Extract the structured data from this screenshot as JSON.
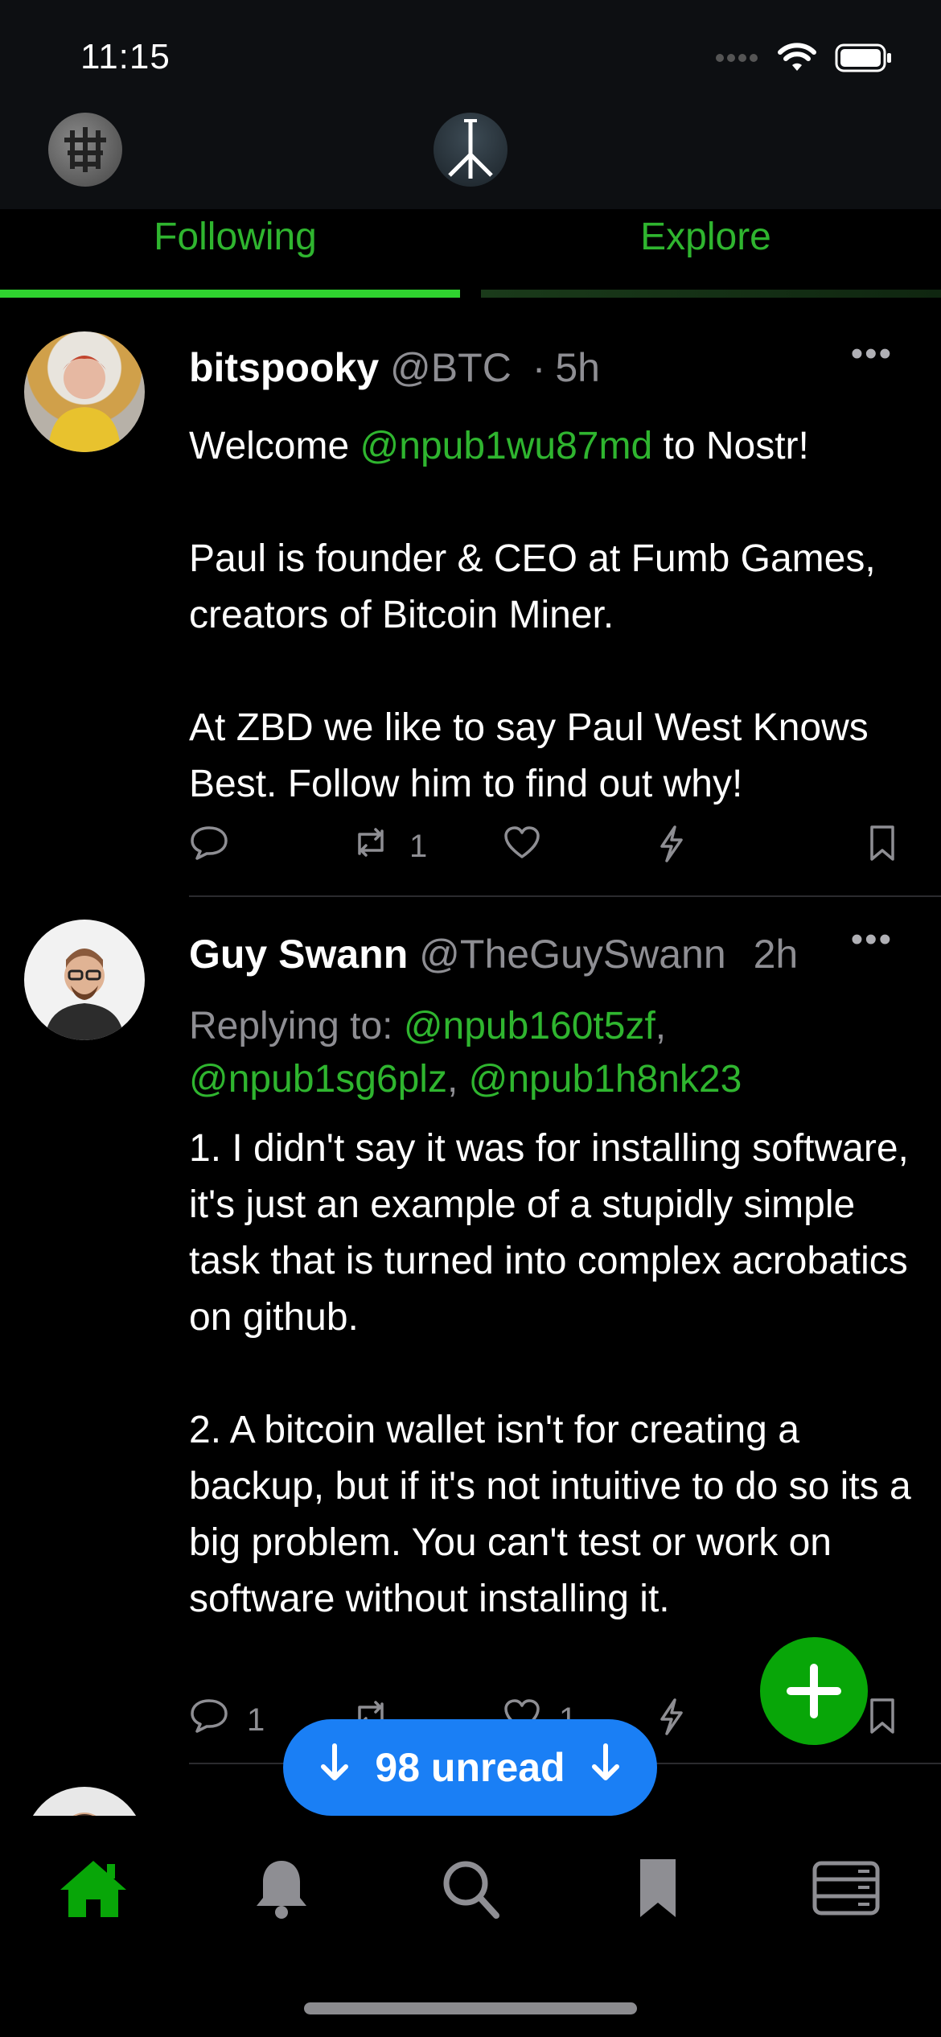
{
  "status_bar": {
    "time": "11:15"
  },
  "header": {
    "profile_avatar": "user-avatar",
    "logo": "app-logo"
  },
  "tabs": [
    {
      "label": "Following",
      "active": true
    },
    {
      "label": "Explore",
      "active": false
    }
  ],
  "posts": [
    {
      "name": "bitspooky",
      "handle": "@BTC",
      "separator": "·",
      "time": "5h",
      "body_prefix": "Welcome ",
      "body_mention": "@npub1wu87md",
      "body_suffix": " to Nostr!\n\nPaul is founder & CEO at Fumb Games, creators of Bitcoin Miner.\n\nAt ZBD we like to say Paul West Knows Best. Follow him to find out why!",
      "counts": {
        "replies": "",
        "reposts": "1",
        "likes": "",
        "zaps": ""
      }
    },
    {
      "name": "Guy Swann",
      "handle": "@TheGuySwann",
      "time": "2h",
      "replying_label": "Replying to: ",
      "replying_mentions": [
        "@npub160t5zf",
        "@npub1sg6plz",
        "@npub1h8nk23"
      ],
      "body": "1. I didn't say it was for installing software, it's just an example of a stupidly simple task that is turned into complex acrobatics on github.\n\n2. A bitcoin wallet isn't for creating a backup, but if it's not intuitive to do so its a big problem. You can't test or work on software without installing it.",
      "counts": {
        "replies": "1",
        "reposts": "",
        "likes": "1",
        "zaps": ""
      }
    }
  ],
  "unread": {
    "label": "98 unread"
  },
  "colors": {
    "accent_green": "#2fb52f",
    "unread_blue": "#1a7ff5",
    "fab_green": "#08a608"
  },
  "bottom_nav": [
    "home-icon",
    "bell-icon",
    "search-icon",
    "bookmark-icon",
    "relays-icon"
  ]
}
